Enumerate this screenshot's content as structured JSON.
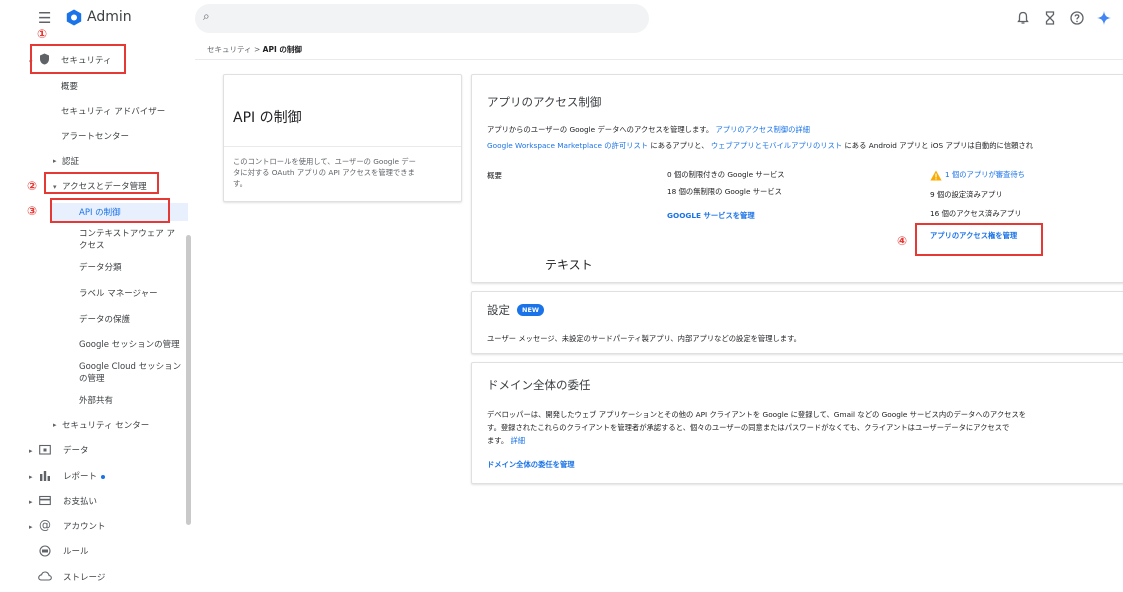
{
  "header": {
    "brand": "Admin",
    "icons": [
      "menu-icon",
      "search-icon",
      "notifications-icon",
      "hourglass-icon",
      "help-icon",
      "gemini-icon"
    ]
  },
  "sidebar": {
    "security": "セキュリティ",
    "overview": "概要",
    "advisor": "セキュリティ アドバイザー",
    "alert_center": "アラートセンター",
    "auth": "認証",
    "access": "アクセスとデータ管理",
    "api": "API の制御",
    "context1": "コンテキストアウェア ア",
    "context2": "クセス",
    "classify": "データ分類",
    "labels": "ラベル マネージャー",
    "protection": "データの保護",
    "gsession": "Google セッションの管理",
    "cloud1": "Google Cloud セッション",
    "cloud2": "の管理",
    "external": "外部共有",
    "sec_center": "セキュリティ センター",
    "data": "データ",
    "reports": "レポート",
    "billing": "お支払い",
    "account": "アカウント",
    "rules": "ルール",
    "storage": "ストレージ"
  },
  "markers": {
    "m1": "①",
    "m2": "②",
    "m3": "③",
    "m4": "④"
  },
  "breadcrumb": {
    "parent": "セキュリティ",
    "sep": ">",
    "current": "API の制御"
  },
  "left_card": {
    "title": "API の制御",
    "desc1": "このコントロールを使用して、ユーザーの Google デー",
    "desc2": "タに対する OAuth アプリの API アクセスを管理できま",
    "desc3": "す。"
  },
  "app_access": {
    "title": "アプリのアクセス制御",
    "line1": "アプリからのユーザーの Google データへのアクセスを管理します。",
    "line1_link": "アプリのアクセス制御の詳細",
    "line2_link1": "Google Workspace Marketplace の許可リスト",
    "line2_mid": "にあるアプリと、",
    "line2_link2": "ウェブアプリとモバイルアプリのリスト",
    "line2_end": "にある Android アプリと iOS アプリは自動的に信頼され",
    "overview_label": "概要",
    "stat1": "0 個の制限付きの Google サービス",
    "stat2": "18 個の無制限の Google サービス",
    "manage_services": "GOOGLE サービスを管理",
    "pending": "1 個のアプリが審査待ち",
    "configured": "9 個の設定済みアプリ",
    "accessed": "16 個のアクセス済みアプリ",
    "manage_access": "アプリのアクセス権を管理",
    "overlay_text": "テキスト"
  },
  "settings": {
    "title": "設定",
    "badge": "NEW",
    "desc": "ユーザー メッセージ、未設定のサードパーティ製アプリ、内部アプリなどの設定を管理します。"
  },
  "delegation": {
    "title": "ドメイン全体の委任",
    "desc1": "デベロッパーは、開発したウェブ アプリケーションとその他の API クライアントを Google に登録して、Gmail などの Google サービス内のデータへのアクセスを",
    "desc2": "す。登録されたこれらのクライアントを管理者が承認すると、個々のユーザーの同意またはパスワードがなくても、クライアントはユーザーデータにアクセスで",
    "desc3": "ます。",
    "detail_link": "詳細",
    "manage": "ドメイン全体の委任を管理"
  },
  "colors": {
    "accent": "#1a73e8",
    "highlight": "#e53935",
    "warning": "#f9ab00"
  }
}
